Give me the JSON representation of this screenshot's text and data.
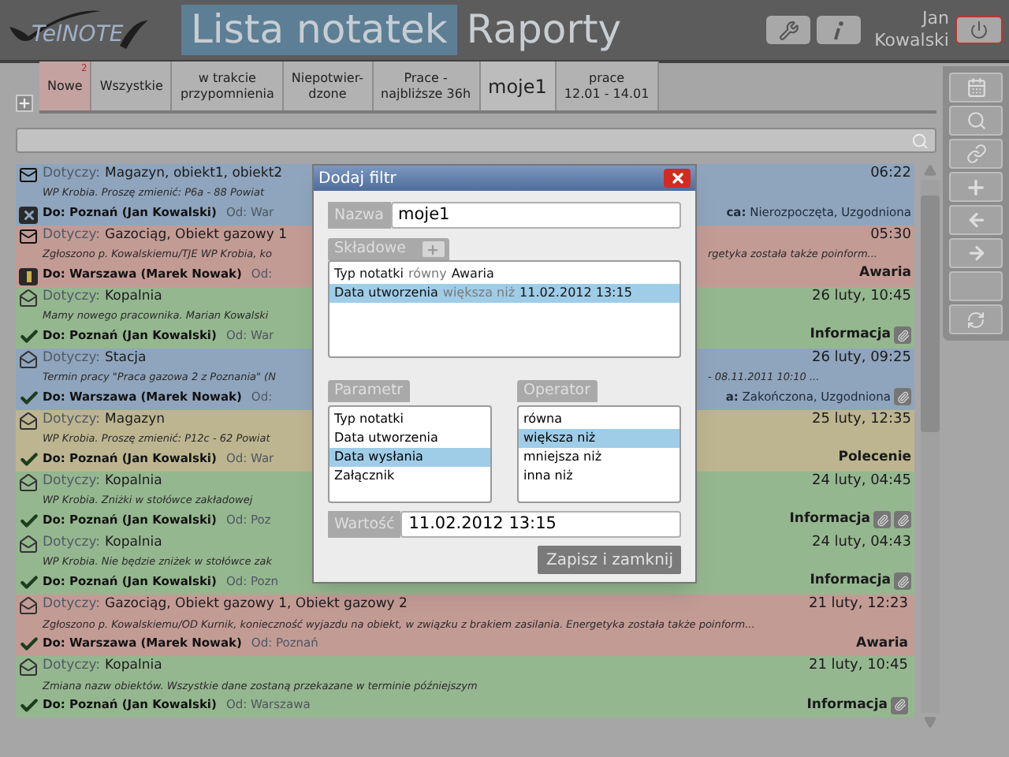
{
  "header": {
    "logo_text": "TelNOTE",
    "nav": [
      {
        "label": "Lista notatek",
        "selected": true
      },
      {
        "label": "Raporty",
        "selected": false
      }
    ],
    "user_name": "Jan Kowalski"
  },
  "tabs": [
    {
      "label": "Nowe",
      "badge": "2",
      "color": "#c4a2a0",
      "selected": false
    },
    {
      "label": "Wszystkie",
      "selected": false
    },
    {
      "label": "w trakcie\nprzypomnienia",
      "selected": false
    },
    {
      "label": "Niepotwier-\ndzone",
      "selected": false
    },
    {
      "label": "Prace -\nnajbliższe 36h",
      "selected": false
    },
    {
      "label": "moje1",
      "selected": true
    },
    {
      "label": "prace\n12.01 - 14.01",
      "selected": false
    }
  ],
  "notes": [
    {
      "color": "#8fa5bd",
      "read": false,
      "kind": "cancel",
      "covered_by_dialog": true,
      "subject_label": "Dotyczy:",
      "subject": "Magazyn, obiekt1, obiekt2",
      "preview": "WP Krobia.  Proszę zmienić: P6a - 88  Powiat",
      "to": "Do: Poznań (Jan Kowalski)",
      "from": "Od: War",
      "time": "06:22",
      "state": "**ca:** Nierozpoczęta, Uzgodniona"
    },
    {
      "color": "#c39b95",
      "read": false,
      "kind": "alert",
      "covered_by_dialog": true,
      "subject_label": "Dotyczy:",
      "subject": "Gazociąg, Obiekt gazowy 1",
      "preview": "Zgłoszono p. Kowalskiemu/TJE WP Krobia, ko",
      "to": "Do: Warszawa (Marek Nowak)",
      "from": "Od:",
      "time": "05:30",
      "preview_tail": "rgetyka została także poinform...",
      "type": "Awaria"
    },
    {
      "color": "#95b78f",
      "read": true,
      "kind": "done",
      "covered_by_dialog": true,
      "subject_label": "Dotyczy:",
      "subject": "Kopalnia",
      "preview": "Mamy nowego pracownika. Marian Kowalski",
      "to": "Do: Poznań (Jan Kowalski)",
      "from": "Od: War",
      "time": "26 luty, 10:45",
      "type": "Informacja",
      "attachments": [
        {
          "kind": "file"
        }
      ]
    },
    {
      "color": "#8fa5bd",
      "read": true,
      "kind": "done",
      "covered_by_dialog": true,
      "subject_label": "Dotyczy:",
      "subject": "Stacja",
      "preview": "Termin pracy \"Praca gazowa 2 z Poznania\" (N",
      "to": "Do: Warszawa (Marek Nowak)",
      "from": "Od:",
      "time": "26 luty, 09:25",
      "preview_tail": "- 08.11.2011 10:10 ...",
      "state": "**a:** Zakończona, Uzgodniona",
      "attachments": [
        {
          "kind": "file"
        }
      ]
    },
    {
      "color": "#bdb58f",
      "read": true,
      "kind": "done",
      "covered_by_dialog": true,
      "subject_label": "Dotyczy:",
      "subject": "Magazyn",
      "preview": "WP Krobia.  Proszę zmienić: P12c - 62  Powiat",
      "to": "Do: Poznań (Jan Kowalski)",
      "from": "Od: War",
      "time": "25 luty, 12:35",
      "type": "Polecenie"
    },
    {
      "color": "#95b78f",
      "read": true,
      "kind": "done",
      "covered_by_dialog": true,
      "subject_label": "Dotyczy:",
      "subject": "Kopalnia",
      "preview": "WP Krobia.  Zniżki w stołówce zakładowej",
      "to": "Do: Poznań (Jan Kowalski)",
      "from": "Od: Poz",
      "time": "24 luty, 04:45",
      "type": "Informacja",
      "attachments": [
        {
          "kind": "file"
        },
        {
          "kind": "file"
        }
      ]
    },
    {
      "color": "#95b78f",
      "read": true,
      "kind": "done",
      "covered_by_dialog": true,
      "subject_label": "Dotyczy:",
      "subject": "Kopalnia",
      "preview": "WP Krobia.  Nie będzie zniżek w stołówce zak",
      "to": "Do: Poznań (Jan Kowalski)",
      "from": "Od: Pozn",
      "time": "24 luty, 04:43",
      "type": "Informacja",
      "attachments": [
        {
          "kind": "file"
        }
      ]
    },
    {
      "color": "#c39b95",
      "read": true,
      "kind": "done",
      "covered_by_dialog": false,
      "subject_label": "Dotyczy:",
      "subject": "Gazociąg, Obiekt gazowy 1, Obiekt gazowy 2",
      "preview": "Zgłoszono p. Kowalskiemu/OD Kurnik, konieczność wyjazdu na obiekt, w związku z brakiem zasilania. Energetyka została także poinform...",
      "to": "Do: Warszawa (Marek Nowak)",
      "from": "Od: Poznań",
      "time": "21 luty, 12:23",
      "type": "Awaria"
    },
    {
      "color": "#95b78f",
      "read": true,
      "kind": "done",
      "covered_by_dialog": false,
      "subject_label": "Dotyczy:",
      "subject": "Kopalnia",
      "preview": "Zmiana nazw obiektów. Wszystkie dane zostaną przekazane w terminie późniejszym",
      "to": "Do: Poznań (Jan Kowalski)",
      "from": "Od: Warszawa",
      "time": "21 luty, 10:45",
      "type": "Informacja",
      "attachments": [
        {
          "kind": "file"
        }
      ]
    }
  ],
  "dialog": {
    "title": "Dodaj filtr",
    "name_label": "Nazwa",
    "name_value": "moje1",
    "components_label": "Składowe",
    "components": [
      {
        "parameter": "Typ notatki",
        "operator": "równy",
        "value": "Awaria",
        "selected": false
      },
      {
        "parameter": "Data utworzenia",
        "operator": "większa niż",
        "value": "11.02.2012 13:15",
        "selected": true
      }
    ],
    "parameter_label": "Parametr",
    "parameters": [
      {
        "label": "Typ notatki",
        "selected": false
      },
      {
        "label": "Data utworzenia",
        "selected": false
      },
      {
        "label": "Data wysłania",
        "selected": true
      },
      {
        "label": "Załącznik",
        "selected": false
      }
    ],
    "operator_label": "Operator",
    "operators": [
      {
        "label": "równa",
        "selected": false
      },
      {
        "label": "większa niż",
        "selected": true
      },
      {
        "label": "mniejsza niż",
        "selected": false
      },
      {
        "label": "inna niż",
        "selected": false
      }
    ],
    "value_label": "Wartość",
    "value": "11.02.2012 13:15",
    "save_button": "Zapisz i zamknij"
  }
}
